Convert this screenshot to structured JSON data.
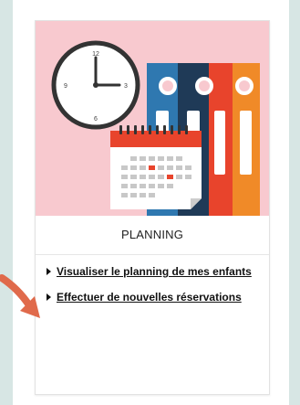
{
  "card": {
    "title": "PLANNING",
    "links": [
      {
        "label": "Visualiser le planning de mes enfants"
      },
      {
        "label": "Effectuer de nouvelles réservations"
      }
    ]
  },
  "icons": {
    "illustration": "planning-illustration-icon",
    "clock": "clock-icon",
    "calendar": "calendar-icon",
    "binders": "binders-icon",
    "link_marker": "triangle-right-icon",
    "pointer": "arrow-icon"
  },
  "colors": {
    "background": "#d7e6e4",
    "image_background": "#f8c9cf",
    "binder_dark": "#1f3a57",
    "binder_blue": "#2f78b0",
    "binder_red": "#e8442c",
    "binder_orange": "#f08a28",
    "arrow": "#e06a4b"
  },
  "clock_numbers": [
    "12",
    "3",
    "6",
    "9"
  ]
}
